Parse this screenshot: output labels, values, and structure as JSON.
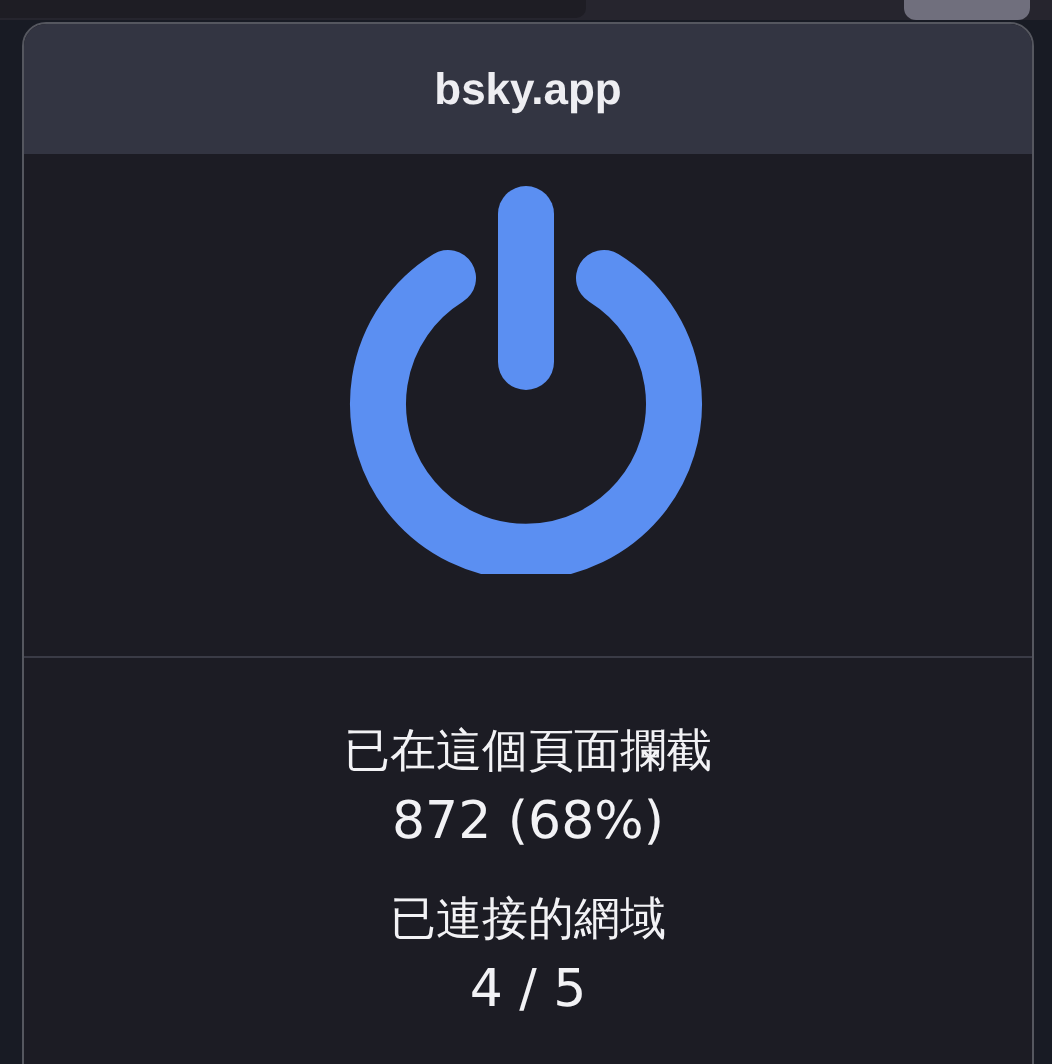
{
  "popup": {
    "title": "bsky.app",
    "power": {
      "on": true
    }
  },
  "stats": [
    {
      "label": "已在這個頁面攔截",
      "value": "872 (68%)"
    },
    {
      "label": "已連接的網域",
      "value": "4 / 5"
    }
  ]
}
